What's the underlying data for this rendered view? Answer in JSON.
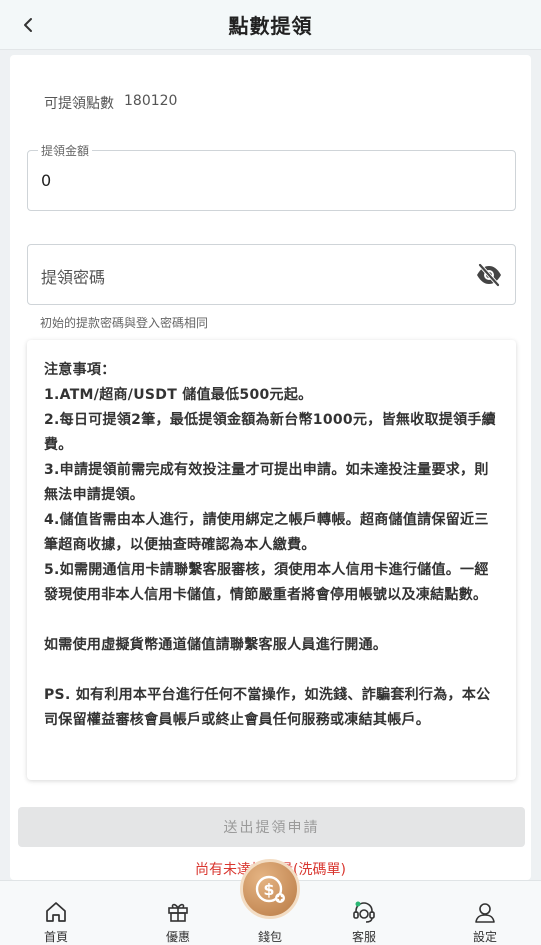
{
  "header": {
    "title": "點數提領"
  },
  "balance": {
    "label": "可提領點數",
    "value": "180120"
  },
  "amount_field": {
    "label": "提領金額",
    "value": "0"
  },
  "password_field": {
    "placeholder": "提領密碼"
  },
  "hint": "初始的提款密碼與登入密碼相同",
  "notice": {
    "title": "注意事項：",
    "lines": [
      "1.ATM/超商/USDT 儲值最低500元起。",
      "2.每日可提領2筆，最低提領金額為新台幣1000元，皆無收取提領手續費。",
      "3.申請提領前需完成有效投注量才可提出申請。如未達投注量要求，則無法申請提領。",
      "4.儲值皆需由本人進行，請使用綁定之帳戶轉帳。超商儲值請保留近三筆超商收據，以便抽查時確認為本人繳費。",
      "5.如需開通信用卡請聯繫客服審核，須使用本人信用卡進行儲值。一經發現使用非本人信用卡儲值，情節嚴重者將會停用帳號以及凍結點數。"
    ],
    "crypto_note": "如需使用虛擬貨幣通道儲值請聯繫客服人員進行開通。",
    "ps": "PS. 如有利用本平台進行任何不當操作，如洗錢、詐騙套利行為，本公司保留權益審核會員帳戶或終止會員任何服務或凍結其帳戶。"
  },
  "submit": {
    "label": "送出提領申請"
  },
  "warning": "尚有未達投注量(洗碼單)",
  "tabbar": {
    "home": "首頁",
    "promo": "優惠",
    "wallet": "錢包",
    "support": "客服",
    "settings": "設定"
  },
  "colors": {
    "warning": "#d9362f",
    "wallet_accent": "#c98a52",
    "support_dot": "#2bb673"
  },
  "icons": [
    "back-arrow-icon",
    "eye-off-icon",
    "home-icon",
    "gift-icon",
    "wallet-coin-icon",
    "headset-icon",
    "user-icon"
  ]
}
